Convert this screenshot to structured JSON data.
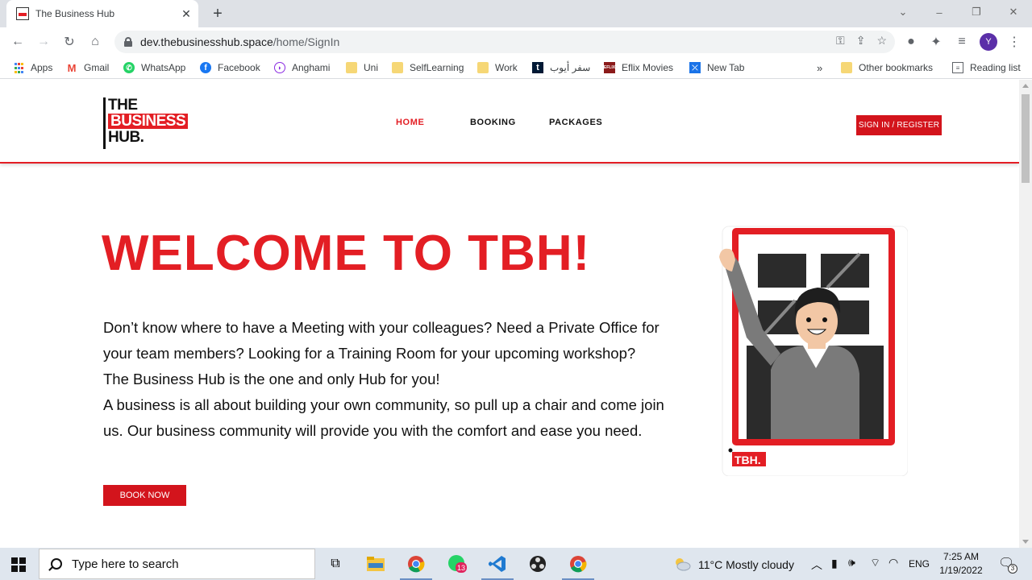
{
  "browser": {
    "tab_title": "The Business Hub",
    "url_host": "dev.thebusinesshub.space",
    "url_path": "/home/SignIn",
    "profile_initial": "Y"
  },
  "bookmarks": [
    {
      "label": "Apps",
      "icon": "apps-grid-icon"
    },
    {
      "label": "Gmail",
      "icon": "gmail-icon"
    },
    {
      "label": "WhatsApp",
      "icon": "whatsapp-icon"
    },
    {
      "label": "Facebook",
      "icon": "facebook-icon"
    },
    {
      "label": "Anghami",
      "icon": "anghami-icon"
    },
    {
      "label": "Uni",
      "icon": "folder-icon"
    },
    {
      "label": "SelfLearning",
      "icon": "folder-icon"
    },
    {
      "label": "Work",
      "icon": "folder-icon"
    },
    {
      "label": "سفر أيوب",
      "icon": "tumblr-icon"
    },
    {
      "label": "Eflix Movies",
      "icon": "eflix-icon"
    },
    {
      "label": "New Tab",
      "icon": "newtab-icon"
    },
    {
      "label": "»",
      "icon": ""
    },
    {
      "label": "Other bookmarks",
      "icon": "folder-icon"
    },
    {
      "label": "Reading list",
      "icon": "reading-list-icon"
    }
  ],
  "site": {
    "logo": {
      "line1": "THE",
      "line2": "BUSINESS",
      "line3": "HUB."
    },
    "nav": [
      {
        "label": "HOME",
        "active": true
      },
      {
        "label": "BOOKING",
        "active": false
      },
      {
        "label": "PACKAGES",
        "active": false
      }
    ],
    "signin_label": "SIGN IN / REGISTER",
    "hero": {
      "title": "WELCOME TO TBH!",
      "lines": [
        "Don’t know where to have a Meeting with your colleagues? Need a Private Office for",
        "your team members? Looking for a Training Room for your upcoming workshop?",
        "The Business Hub is the one and only Hub for you!",
        "A business is all about building your own community, so pull up a chair and come join",
        "us. Our business community will provide you with the comfort and ease you need."
      ],
      "book_label": "BOOK NOW"
    },
    "illustration_badge": "TBH."
  },
  "taskbar": {
    "search_placeholder": "Type here to search",
    "whatsapp_badge": "13",
    "weather": "11°C  Mostly cloudy",
    "language": "ENG",
    "time": "7:25 AM",
    "date": "1/19/2022",
    "notification_count": "3"
  },
  "colors": {
    "brand_red": "#e31e24",
    "button_red": "#d3141c"
  }
}
